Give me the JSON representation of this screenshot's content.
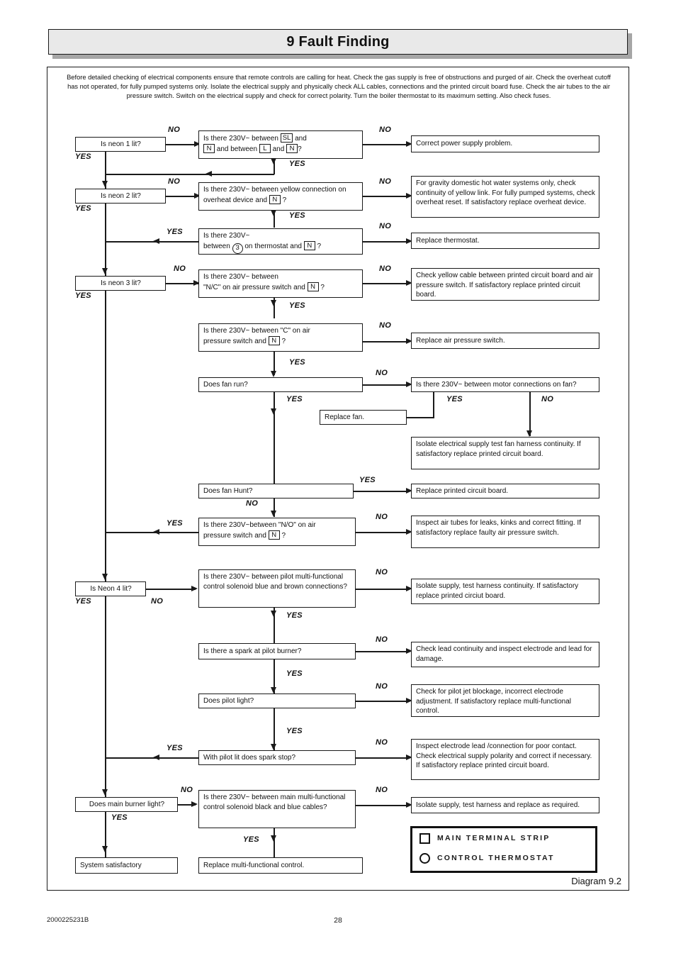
{
  "header": {
    "title": "9 Fault Finding"
  },
  "intro": "Before detailed checking of electrical components ensure that remote controls are calling for heat.  Check the gas supply is free of obstructions and purged of air.  Check the overheat cutoff has not operated,  for fully pumped systems only.  Isolate the electrical supply and physically check ALL cables, connections and the printed circuit board fuse.   Check the air tubes to the air pressure switch.  Switch on the electrical supply and check for correct polarity.  Turn the boiler thermostat to its maximum setting. Also check fuses.",
  "questions": {
    "neon1": "Is neon 1 lit?",
    "neon2": "Is neon 2 lit?",
    "neon3": "Is neon 3 lit?",
    "neon4": "Is Neon  4 lit?",
    "q_sl_n": {
      "p1": "Is there 230V~ between",
      "t1": "SL",
      "p2": "and",
      "t2": "N",
      "p3": "and between",
      "t3": "L",
      "p4": "and",
      "t4": "N",
      "p5": "?"
    },
    "q_overheat": {
      "p1": "Is there 230V~ between yellow connection on overheat device and",
      "t1": "N",
      "p2": "?"
    },
    "q_thermostat": {
      "p1": "Is there 230V~",
      "p2": "between",
      "t1": "3",
      "p3": "on thermostat and",
      "t2": "N",
      "p4": "?"
    },
    "q_nc": {
      "p1": "Is there 230V~ between",
      "p2": "\"N/C\" on air pressure switch and",
      "t1": "N",
      "p3": "?"
    },
    "q_c": {
      "p1": "Is there 230V~ between   \"C\"   on air",
      "p2": "pressure switch and",
      "t1": "N",
      "p3": "?"
    },
    "q_no": {
      "p1": "Is there 230V~between   \"N/O\"   on  air",
      "p2": "pressure switch and",
      "t1": "N",
      "p3": "?"
    },
    "fan_run": "Does fan run?",
    "fan_hunt": "Does fan Hunt?",
    "motor_conn": "Is there 230V~ between motor connections on fan?",
    "pilot_solenoid": "Is there 230V~ between pilot multi-functional control solenoid blue and brown connections?",
    "spark_pilot": "Is there a spark at pilot burner?",
    "pilot_light": "Does pilot light?",
    "spark_stop": "With pilot lit does spark stop?",
    "main_burner": "Does main burner light?",
    "main_solenoid": "Is there 230V~  between main multi-functional control solenoid black and blue cables?"
  },
  "actions": {
    "power_supply": "Correct power supply problem.",
    "gravity": "For gravity domestic hot water systems only, check continuity of yellow link.  For fully pumped systems,  check overheat reset. If satisfactory replace overheat device.",
    "replace_thermostat": "Replace thermostat.",
    "yellow_cable": "Check yellow cable between printed circuit board and air pressure switch. If satisfactory replace printed circuit board.",
    "replace_aps": "Replace air pressure switch.",
    "replace_fan": "Replace fan.",
    "isolate_fan": "Isolate electrical supply test fan harness continuity. If satisfactory replace printed circuit board.",
    "replace_pcb": "Replace printed circuit board.",
    "air_tubes": "Inspect air tubes for leaks, kinks and correct fitting. If satisfactory replace faulty air pressure switch.",
    "isolate_harness": "Isolate supply, test harness continuity. If satisfactory replace printed circiut board.",
    "lead_continuity": "Check lead continuity and inspect electrode and lead for damage.",
    "pilot_jet": "Check for pilot jet blockage, incorrect electrode adjustment.  If satisfactory replace multi-functional control.",
    "electrode_lead": "Inspect electrode lead /connection for poor contact.  Check electrical supply polarity and correct if necessary. If satisfactory replace printed circuit board.",
    "isolate_replace": "Isolate supply, test harness and replace as required.",
    "system_ok": "System satisfactory",
    "replace_mfc": "Replace multi-functional control."
  },
  "branch_labels": {
    "yes": "YES",
    "no": "NO"
  },
  "legend": {
    "terminal_strip": "MAIN TERMINAL STRIP",
    "control_thermostat": "CONTROL THERMOSTAT"
  },
  "caption": "Diagram 9.2",
  "footer": {
    "code": "2000225231B",
    "page": "28"
  }
}
